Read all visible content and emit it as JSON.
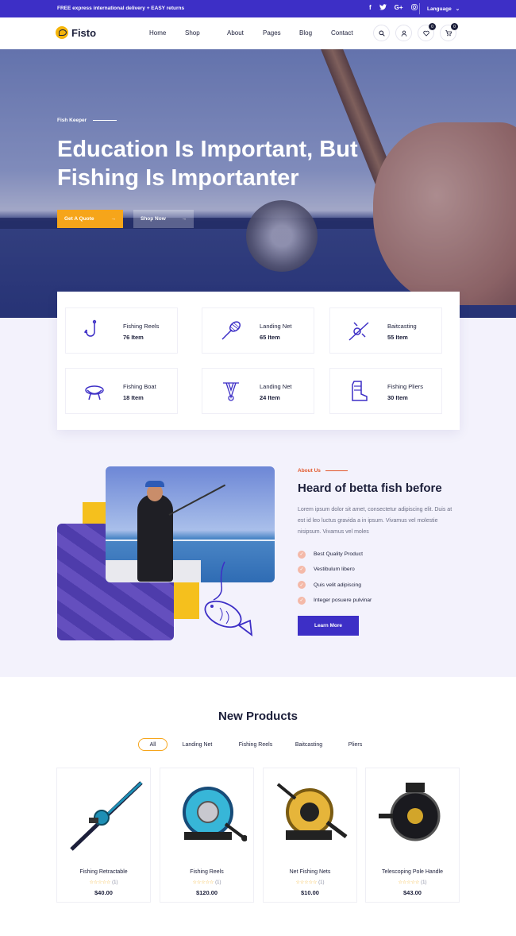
{
  "topbar": {
    "promo": "FREE express international delivery + EASY returns",
    "social": [
      "f",
      "t",
      "G+",
      "ig"
    ],
    "language": "Language"
  },
  "brand": {
    "name": "Fisto"
  },
  "menu": [
    "Home",
    "Shop",
    "About",
    "Pages",
    "Blog",
    "Contact"
  ],
  "nav_icons": {
    "wishlist_count": "0",
    "cart_count": "0"
  },
  "hero": {
    "kicker": "Fish Keeper",
    "title_line1": "Education Is Important, But",
    "title_line2": "Fishing Is Importanter",
    "btn_quote": "Get A Quote",
    "btn_shop": "Shop Now"
  },
  "categories": [
    {
      "name": "Fishing Reels",
      "count": "76 Item",
      "icon": "hook-icon"
    },
    {
      "name": "Landing Net",
      "count": "65 Item",
      "icon": "landing-net-icon"
    },
    {
      "name": "Baitcasting",
      "count": "55 Item",
      "icon": "baitcasting-icon"
    },
    {
      "name": "Fishing Boat",
      "count": "18 Item",
      "icon": "fishing-boat-icon"
    },
    {
      "name": "Landing Net",
      "count": "24 Item",
      "icon": "net-icon"
    },
    {
      "name": "Fishing Pliers",
      "count": "30 Item",
      "icon": "boot-icon"
    }
  ],
  "about": {
    "kicker": "About Us",
    "title": "Heard of betta fish before",
    "text": "Lorem ipsum dolor sit amet, consectetur adipiscing elit. Duis at est id leo luctus gravida a in ipsum. Vivamus vel molestie nisipsum. Vivamus vel moles",
    "checks": [
      "Best Quality Product",
      "Vestibulum libero",
      "Quis velit adipiscing",
      "Integer posuere pulvinar"
    ],
    "button": "Learn More"
  },
  "products_section": {
    "title": "New Products",
    "tabs": [
      "All",
      "Landing Net",
      "Fishing Reels",
      "Baitcasting",
      "Pliers"
    ],
    "active_tab": "All"
  },
  "products": [
    {
      "name": "Fishing Retractable",
      "stars": "☆☆☆☆☆",
      "reviews": "(1)",
      "price": "$40.00"
    },
    {
      "name": "Fishing Reels",
      "stars": "☆☆☆☆☆",
      "reviews": "(1)",
      "price": "$120.00"
    },
    {
      "name": "Net Fishing Nets",
      "stars": "☆☆☆☆☆",
      "reviews": "(1)",
      "price": "$10.00"
    },
    {
      "name": "Telescoping Pole Handle",
      "stars": "☆☆☆☆☆",
      "reviews": "(1)",
      "price": "$43.00"
    }
  ],
  "colors": {
    "primary": "#3d2fc6",
    "accent": "#f6a51a",
    "yellow": "#f5c01d",
    "dark": "#1c1f3a"
  }
}
